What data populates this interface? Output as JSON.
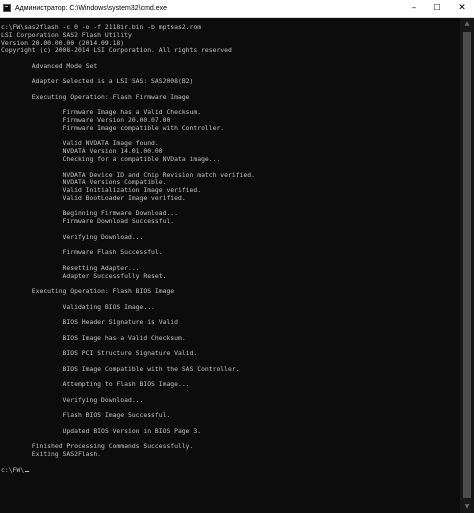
{
  "window": {
    "title": "Администратор: C:\\Windows\\system32\\cmd.exe",
    "icon": "cmd-icon",
    "controls": {
      "minimize": "–",
      "maximize": "☐",
      "close": "✕"
    }
  },
  "console": {
    "lines": [
      "c:\\FW\\sas2flash -c 0 -o -f 2118ir.bin -b mptsas2.rom",
      "LSI Corporation SAS2 Flash Utility",
      "Version 20.00.00.00 (2014.09.18)",
      "Copyright (c) 2008-2014 LSI Corporation. All rights reserved",
      "",
      "        Advanced Mode Set",
      "",
      "        Adapter Selected is a LSI SAS: SAS2008(B2)",
      "",
      "        Executing Operation: Flash Firmware Image",
      "",
      "                Firmware Image has a Valid Checksum.",
      "                Firmware Version 20.00.07.00",
      "                Firmware Image compatible with Controller.",
      "",
      "                Valid NVDATA Image found.",
      "                NVDATA Version 14.01.00.00",
      "                Checking for a compatible NVData image...",
      "",
      "                NVDATA Device ID and Chip Revision match verified.",
      "                NVDATA Versions Compatible.",
      "                Valid Initialization Image verified.",
      "                Valid BootLoader Image verified.",
      "",
      "                Beginning Firmware Download...",
      "                Firmware Download Successful.",
      "",
      "                Verifying Download...",
      "",
      "                Firmware Flash Successful.",
      "",
      "                Resetting Adapter...",
      "                Adapter Successfully Reset.",
      "",
      "        Executing Operation: Flash BIOS Image",
      "",
      "                Validating BIOS Image...",
      "",
      "                BIOS Header Signature is Valid",
      "",
      "                BIOS Image has a Valid Checksum.",
      "",
      "                BIOS PCI Structure Signature Valid.",
      "",
      "                BIOS Image Compatible with the SAS Controller.",
      "",
      "                Attempting to Flash BIOS Image...",
      "",
      "                Verifying Download...",
      "",
      "                Flash BIOS Image Successful.",
      "",
      "                Updated BIOS Version in BIOS Page 3.",
      "",
      "        Finished Processing Commands Successfully.",
      "        Exiting SAS2Flash.",
      "",
      "c:\\FW\\"
    ]
  },
  "scrollbar": {
    "up_icon": "scroll-up-arrow-icon",
    "down_icon": "scroll-down-arrow-icon",
    "up_glyph": "▲",
    "down_glyph": "▼"
  },
  "colors": {
    "background": "#0c0c0c",
    "text": "#c0c0c0",
    "titlebar": "#ffffff"
  }
}
